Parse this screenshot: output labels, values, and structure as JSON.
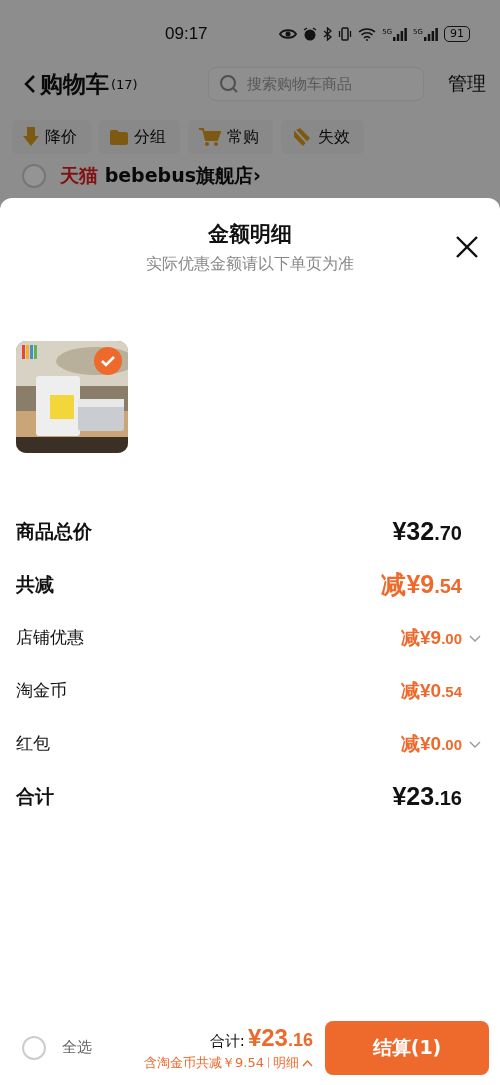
{
  "status_bar": {
    "time": "09:17",
    "signals": [
      "5G",
      "5G"
    ],
    "battery": "91"
  },
  "header": {
    "title": "购物车",
    "count": "(17)",
    "search": {
      "placeholder": "搜索购物车商品"
    },
    "manage": "管理"
  },
  "filters": [
    {
      "label": "降价",
      "kind": "down"
    },
    {
      "label": "分组",
      "kind": "folder"
    },
    {
      "label": "常购",
      "kind": "cart"
    },
    {
      "label": "失效",
      "kind": "expired"
    }
  ],
  "store": {
    "badge": "天猫",
    "name": "bebebus旗舰店",
    "arrow": "›",
    "selected": false
  },
  "sheet": {
    "title": "金额明细",
    "subtitle": "实际优惠金额请以下单页为准",
    "products": [
      {
        "kind": "picture",
        "selected": true
      }
    ],
    "rows": [
      {
        "kind": "total",
        "label": "商品总价",
        "amount": "¥32.70",
        "accent": false
      },
      {
        "kind": "total",
        "label": "共减",
        "amount": "减¥9.54",
        "accent": true
      },
      {
        "kind": "item",
        "label": "店铺优惠",
        "amount": "减¥9.00",
        "accent": true,
        "expandable": true
      },
      {
        "kind": "item",
        "label": "淘金币",
        "amount": "减¥0.54",
        "accent": true,
        "expandable": false
      },
      {
        "kind": "item",
        "label": "红包",
        "amount": "减¥0.00",
        "accent": true,
        "expandable": true
      },
      {
        "kind": "total",
        "label": "合计",
        "amount": "¥23.16",
        "accent": false
      }
    ]
  },
  "footer": {
    "select_all": {
      "label": "全选",
      "checked": false
    },
    "total_label": "合计:",
    "total": "¥23.16",
    "savings": "含淘金币共减￥9.54",
    "detail_link": "明细",
    "checkout": "结算(1)"
  }
}
